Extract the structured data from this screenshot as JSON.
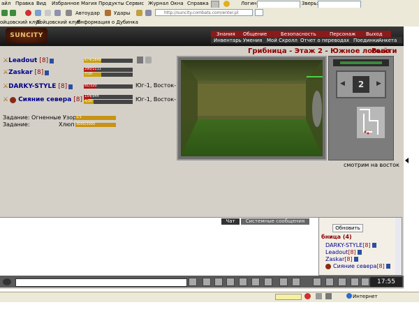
{
  "menu": [
    "айл",
    "Правка",
    "Вид",
    "Избранное",
    "Магия",
    "Продукты",
    "Сервис",
    "Журнал",
    "Окна",
    "Справка"
  ],
  "toolbar": {
    "autoudar": "Автоудар",
    "udary": "Удары",
    "login_label": "Логин:",
    "zver_label": "Зверь:"
  },
  "address": {
    "url": "http://suncity.combats.com/enter.pl"
  },
  "links": [
    "ойцовский клуб",
    "Бойцовский клуб",
    "Информация о Дубинка"
  ],
  "logo": "SUNCITY",
  "nav_top": [
    "Знания",
    "Общение",
    "Безопасность",
    "Персонаж",
    "Выход"
  ],
  "nav_bottom": [
    "Инвентарь",
    "Умения",
    "Мой Скролл",
    "Отчет о переводах",
    "Поединки",
    "Анкета"
  ],
  "location": {
    "title": "Грибница - Этаж 2 - Южное логово",
    "leave": "Выйти",
    "caption": "смотрим на восток",
    "level_badge": "2"
  },
  "party": [
    {
      "name": "Leadout",
      "level": "[8]",
      "hp_text": "674/1848",
      "hp": 0.36,
      "mana_text": "",
      "coord": ""
    },
    {
      "name": "Zaskar",
      "level": "[8]",
      "hp_text": "290/1111",
      "hp": 0.26,
      "mana_text": "7/20",
      "coord": ""
    },
    {
      "name": "DARKY-STYLE",
      "level": "[8]",
      "hp_text": "81/320",
      "hp": 0.25,
      "mana_text": "",
      "coord": "Юг-1, Восток-1"
    },
    {
      "name": "Сияние севера",
      "level": "[8]",
      "hp_text": "154/944",
      "hp": 0.16,
      "mana_text": "4/20",
      "coord": "Юг-1, Восток-1"
    }
  ],
  "tasks": [
    {
      "label": "Задание: Огненные Узоры",
      "value": "1/1"
    },
    {
      "label": "Задание:",
      "sub": "Хлюп",
      "value": "3000/3000"
    }
  ],
  "chat": {
    "tab_chat": "Чат",
    "tab_system": "Системные сообщения"
  },
  "online": {
    "refresh": "Обновить",
    "room": "бница (4)",
    "users": [
      {
        "name": "DARKY-STYLE",
        "level": "[8]"
      },
      {
        "name": "Leadout",
        "level": "[8]"
      },
      {
        "name": "Zaskar",
        "level": "[8]"
      },
      {
        "name": "Сияние севера",
        "level": "[8]"
      }
    ]
  },
  "clock": "17:55",
  "status": {
    "zone": "Интернет"
  }
}
